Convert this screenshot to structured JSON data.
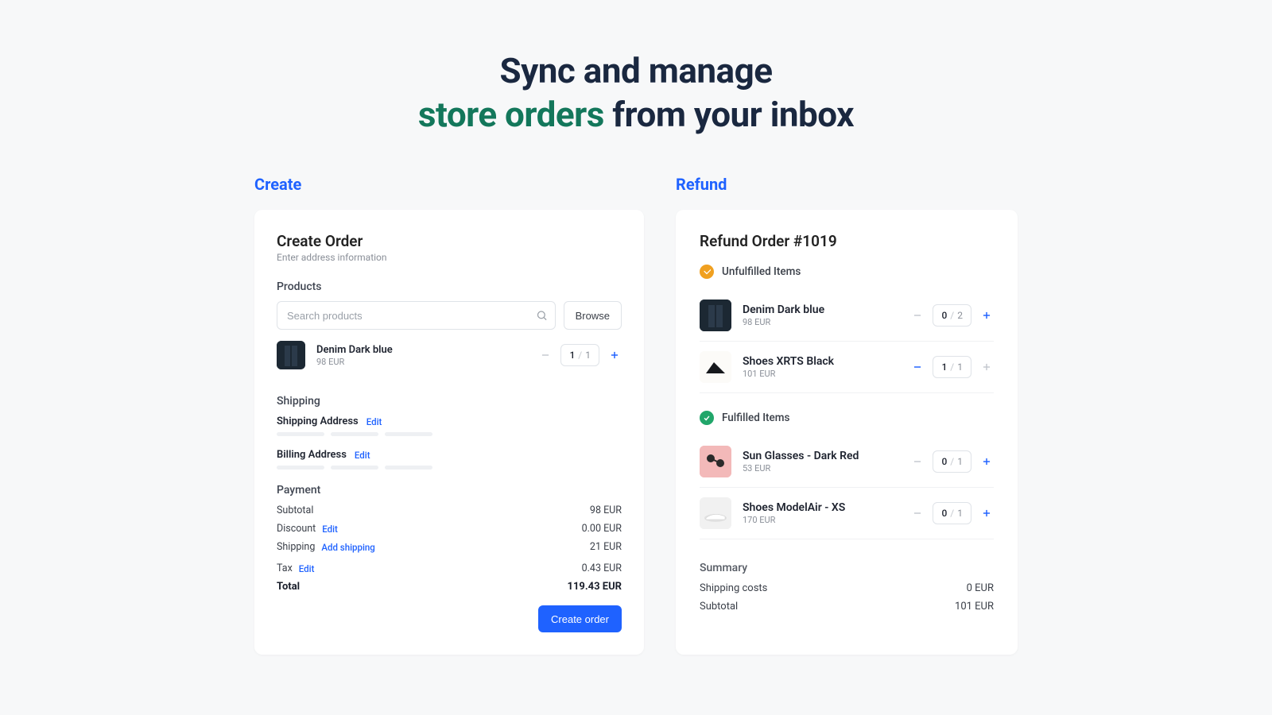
{
  "headline": {
    "part1": "Sync and manage",
    "accent": "store orders",
    "part2": " from your inbox"
  },
  "create": {
    "tab": "Create",
    "title": "Create Order",
    "subtitle": "Enter address information",
    "products_heading": "Products",
    "search_placeholder": "Search products",
    "browse": "Browse",
    "product": {
      "name": "Denim Dark blue",
      "price": "98 EUR",
      "qty": "1",
      "of": "1"
    },
    "shipping_heading": "Shipping",
    "shipping_addr_label": "Shipping Address",
    "billing_addr_label": "Billing Address",
    "edit": "Edit",
    "payment_heading": "Payment",
    "subtotal_label": "Subtotal",
    "subtotal_value": "98 EUR",
    "discount_label": "Discount",
    "discount_value": "0.00 EUR",
    "shipping_label": "Shipping",
    "add_shipping": "Add shipping",
    "shipping_value": "21 EUR",
    "tax_label": "Tax",
    "tax_value": "0.43 EUR",
    "total_label": "Total",
    "total_value": "119.43 EUR",
    "create_order_btn": "Create order"
  },
  "refund": {
    "tab": "Refund",
    "title": "Refund Order #1019",
    "unfulfilled": "Unfulfilled Items",
    "fulfilled": "Fulfilled Items",
    "items_unfulfilled": [
      {
        "name": "Denim Dark blue",
        "price": "98 EUR",
        "qty": "0",
        "of": "2",
        "minus_active": false,
        "plus_active": true
      },
      {
        "name": "Shoes XRTS Black",
        "price": "101 EUR",
        "qty": "1",
        "of": "1",
        "minus_active": true,
        "plus_active": false
      }
    ],
    "items_fulfilled": [
      {
        "name": "Sun Glasses - Dark Red",
        "price": "53 EUR",
        "qty": "0",
        "of": "1"
      },
      {
        "name": "Shoes ModelAir - XS",
        "price": "170 EUR",
        "qty": "0",
        "of": "1"
      }
    ],
    "summary_heading": "Summary",
    "shipping_costs_label": "Shipping costs",
    "shipping_costs_value": "0 EUR",
    "subtotal_label": "Subtotal",
    "subtotal_value": "101 EUR"
  }
}
